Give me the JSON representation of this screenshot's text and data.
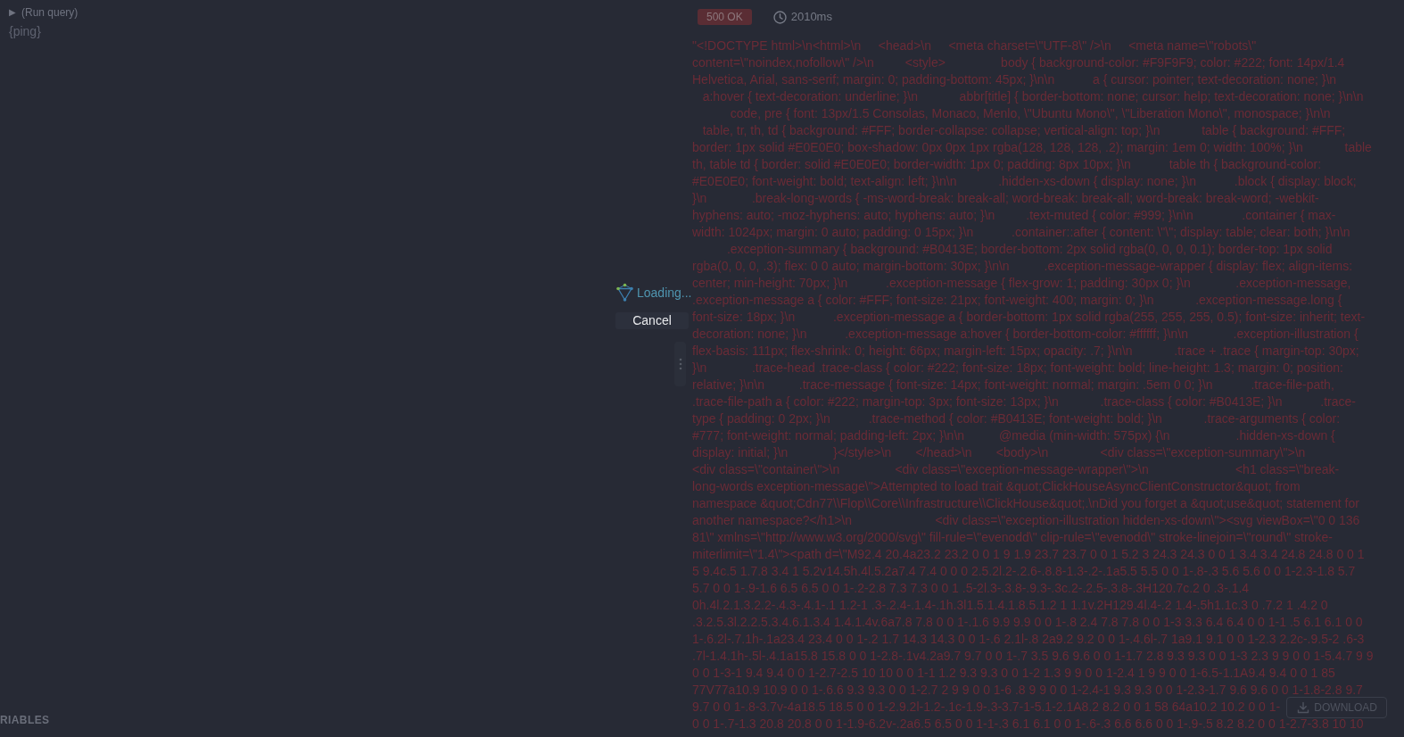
{
  "editor": {
    "run_icon": "▶",
    "run_label": "(Run query)",
    "query": "{ping}",
    "variables_tab": "RIABLES"
  },
  "response": {
    "status": "500 OK",
    "time": "2010ms",
    "download": "DOWNLOAD",
    "lines": [
      "\"<!DOCTYPE html>\\n<html>\\n     <head>\\n     <meta charset=\\\"UTF-8\\\" />\\n     <meta name=\\\"robots\\\"",
      "content=\\\"noindex,nofollow\\\" />\\n         <style>                body { background-color: #F9F9F9; color: #222; font: 14px/1.4",
      "Helvetica, Arial, sans-serif; margin: 0; padding-bottom: 45px; }\\n\\n           a { cursor: pointer; text-decoration: none; }\\n",
      "   a:hover { text-decoration: underline; }\\n            abbr[title] { border-bottom: none; cursor: help; text-decoration: none; }\\n\\n",
      "           code, pre { font: 13px/1.5 Consolas, Monaco, Menlo, \\\"Ubuntu Mono\\\", \\\"Liberation Mono\\\", monospace; }\\n\\n",
      "   table, tr, th, td { background: #FFF; border-collapse: collapse; vertical-align: top; }\\n            table { background: #FFF;",
      "border: 1px solid #E0E0E0; box-shadow: 0px 0px 1px rgba(128, 128, 128, .2); margin: 1em 0; width: 100%; }\\n            table",
      "th, table td { border: solid #E0E0E0; border-width: 1px 0; padding: 8px 10px; }\\n           table th { background-color:",
      "#E0E0E0; font-weight: bold; text-align: left; }\\n\\n            .hidden-xs-down { display: none; }\\n           .block { display: block;",
      "}\\n             .break-long-words { -ms-word-break: break-all; word-break: break-all; word-break: break-word; -webkit-",
      "hyphens: auto; -moz-hyphens: auto; hyphens: auto; }\\n         .text-muted { color: #999; }\\n\\n              .container { max-",
      "width: 1024px; margin: 0 auto; padding: 0 15px; }\\n           .container::after { content: \\\"\\\"; display: table; clear: both; }\\n\\n",
      "          .exception-summary { background: #B0413E; border-bottom: 2px solid rgba(0, 0, 0, 0.1); border-top: 1px solid",
      "rgba(0, 0, 0, .3); flex: 0 0 auto; margin-bottom: 30px; }\\n\\n          .exception-message-wrapper { display: flex; align-items:",
      "center; min-height: 70px; }\\n           .exception-message { flex-grow: 1; padding: 30px 0; }\\n             .exception-message,",
      ".exception-message a { color: #FFF; font-size: 21px; font-weight: 400; margin: 0; }\\n            .exception-message.long {",
      "font-size: 18px; }\\n           .exception-message a { border-bottom: 1px solid rgba(255, 255, 255, 0.5); font-size: inherit; text-",
      "decoration: none; }\\n           .exception-message a:hover { border-bottom-color: #ffffff; }\\n\\n             .exception-illustration {",
      "flex-basis: 111px; flex-shrink: 0; height: 66px; margin-left: 15px; opacity: .7; }\\n\\n            .trace + .trace { margin-top: 30px;",
      "}\\n             .trace-head .trace-class { color: #222; font-size: 18px; font-weight: bold; line-height: 1.3; margin: 0; position:",
      "relative; }\\n\\n          .trace-message { font-size: 14px; font-weight: normal; margin: .5em 0 0; }\\n           .trace-file-path,",
      ".trace-file-path a { color: #222; margin-top: 3px; font-size: 13px; }\\n            .trace-class { color: #B0413E; }\\n           .trace-",
      "type { padding: 0 2px; }\\n           .trace-method { color: #B0413E; font-weight: bold; }\\n            .trace-arguments { color:",
      "#777; font-weight: normal; padding-left: 2px; }\\n\\n          @media (min-width: 575px) {\\n                   .hidden-xs-down {",
      "display: initial; }\\n             }</style>\\n       </head>\\n       <body>\\n               <div class=\\\"exception-summary\\\">\\n",
      "<div class=\\\"container\\\">\\n                <div class=\\\"exception-message-wrapper\\\">\\n                         <h1 class=\\\"break-",
      "long-words exception-message\\\">Attempted to load trait &quot;ClickHouseAsyncClientConstructor&quot; from",
      "namespace &quot;Cdn77\\\\Flop\\\\Core\\\\Infrastructure\\\\ClickHouse&quot;.\\nDid you forget a &quot;use&quot; statement for",
      "another namespace?</h1>\\n                        <div class=\\\"exception-illustration hidden-xs-down\\\"><svg viewBox=\\\"0 0 136",
      "81\\\" xmlns=\\\"http://www.w3.org/2000/svg\\\" fill-rule=\\\"evenodd\\\" clip-rule=\\\"evenodd\\\" stroke-linejoin=\\\"round\\\" stroke-",
      "miterlimit=\\\"1.4\\\"><path d=\\\"M92.4 20.4a23.2 23.2 0 0 1 9 1.9 23.7 23.7 0 0 1 5.2 3 24.3 24.3 0 0 1 3.4 3.4 24.8 24.8 0 0 1",
      "5 9.4c.5 1.7.8 3.4 1 5.2v14.5h.4l.5.2a7.4 7.4 0 0 0 2.5.2l.2-.2.6-.8.8-1.3-.2-.1a5.5 5.5 0 0 1-.8-.3 5.6 5.6 0 0 1-2.3-1.8 5.7",
      "5.7 0 0 1-.9-1.6 6.5 6.5 0 0 1-.2-2.8 7.3 7.3 0 0 1 .5-2l.3-.3.8-.9.3-.3c.2-.2.5-.3.8-.3H120.7c.2 0 .3-.1.4",
      "0h.4l.2.1.3.2.2-.4.3-.4.1-.1 1.2-1 .3-.2.4-.1.4-.1h.3l1.5.1.4.1.8.5.1.2 1 1.1v.2H129.4l.4-.2 1.4-.5h1.1c.3 0 .7.2 1 .4.2 0",
      ".3.2.5.3l.2.2.5.3.4.6.1.3.4 1.4.1.4v.6a7.8 7.8 0 0 1-.1.6 9.9 9.9 0 0 1-.8 2.4 7.8 7.8 0 0 1-3 3.3 6.4 6.4 0 0 1-1 .5 6.1 6.1 0 0",
      "1-.6.2l-.7.1h-.1a23.4 23.4 0 0 1-.2 1.7 14.3 14.3 0 0 1-.6 2.1l-.8 2a9.2 9.2 0 0 1-.4.6l-.7 1a9.1 9.1 0 0 1-2.3 2.2c-.9.5-2 .6-3",
      ".7l-1.4.1h-.5l-.4.1a15.8 15.8 0 0 1-2.8-.1v4.2a9.7 9.7 0 0 1-.7 3.5 9.6 9.6 0 0 1-1.7 2.8 9.3 9.3 0 0 1-3 2.3 9 9 0 0 1-5.4.7 9 9",
      "0 0 1-3-1 9.4 9.4 0 0 1-2.7-2.5 10 10 0 0 1-1 1.2 9.3 9.3 0 0 1-2 1.3 9 9 0 0 1-2.4 1 9 9 0 0 1-6.5-1.1A9.4 9.4 0 0 1 85",
      "77V77a10.9 10.9 0 0 1-.6.6 9.3 9.3 0 0 1-2.7 2 9 9 0 0 1-6 .8 9 9 0 0 1-2.4-1 9.3 9.3 0 0 1-2.3-1.7 9.6 9.6 0 0 1-1.8-2.8 9.7",
      "9.7 0 0 1-.8-3.7v-4a18.5 18.5 0 0 1-2.9.2l-1.2-.1c-1.9-.3-3.7-1-5.1-2.1A8.2 8.2 0 0 1 58 64a10.2 10.2 0 0 1-",
      "0 0 1-.7-1.3 20.8 20.8 0 0 1-1.9-6.2v-.2a6.5 6.5 0 0 1-1-.3 6.1 6.1 0 0 1-.6-.3 6.6 6.6 0 0 1-.9-.5 8.2 8.2 0 0 1-2.7-3.8 10 10"
    ]
  },
  "loading": {
    "message": "Loading...",
    "cancel": "Cancel"
  }
}
